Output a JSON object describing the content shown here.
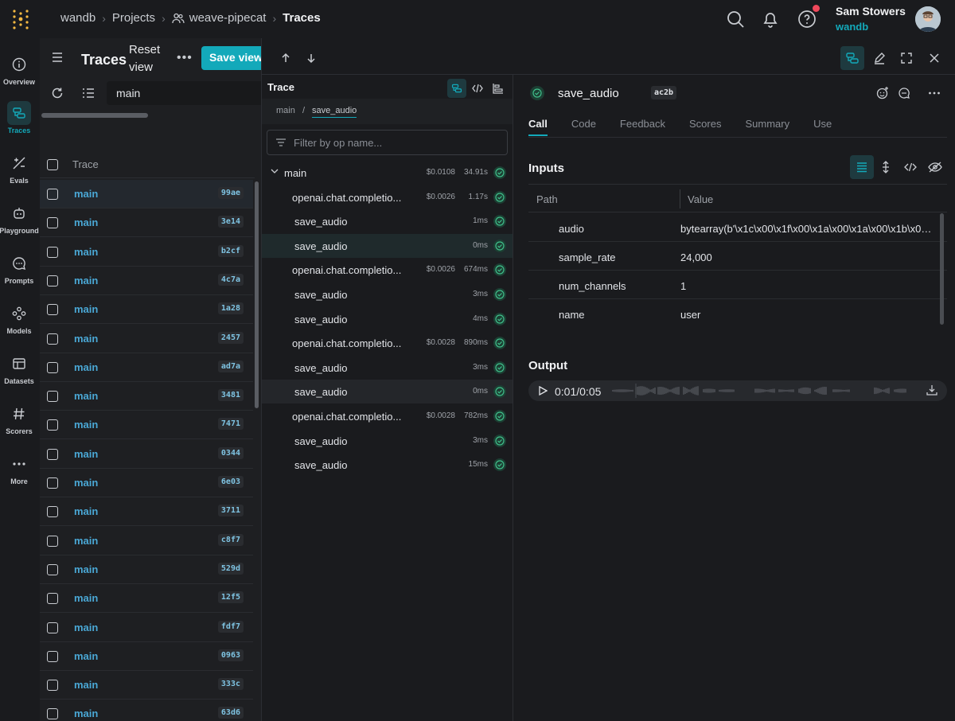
{
  "header": {
    "breadcrumbs": [
      "wandb",
      "Projects",
      "weave-pipecat",
      "Traces"
    ],
    "user_name": "Sam Stowers",
    "user_org": "wandb"
  },
  "nav": [
    {
      "label": "Overview",
      "icon": "info-icon"
    },
    {
      "label": "Traces",
      "icon": "traces-icon",
      "active": true
    },
    {
      "label": "Evals",
      "icon": "evals-icon"
    },
    {
      "label": "Playground",
      "icon": "robot-icon"
    },
    {
      "label": "Prompts",
      "icon": "chat-icon"
    },
    {
      "label": "Models",
      "icon": "models-icon"
    },
    {
      "label": "Datasets",
      "icon": "table-icon"
    },
    {
      "label": "Scorers",
      "icon": "hash-icon"
    },
    {
      "label": "More",
      "icon": "more-icon"
    }
  ],
  "list": {
    "title": "Traces",
    "reset_view": "Reset view",
    "save_view": "Save view",
    "filter_value": "main",
    "column_header": "Trace",
    "rows": [
      {
        "op": "main",
        "id": "99ae"
      },
      {
        "op": "main",
        "id": "3e14"
      },
      {
        "op": "main",
        "id": "b2cf"
      },
      {
        "op": "main",
        "id": "4c7a"
      },
      {
        "op": "main",
        "id": "1a28"
      },
      {
        "op": "main",
        "id": "2457"
      },
      {
        "op": "main",
        "id": "ad7a"
      },
      {
        "op": "main",
        "id": "3481"
      },
      {
        "op": "main",
        "id": "7471"
      },
      {
        "op": "main",
        "id": "0344"
      },
      {
        "op": "main",
        "id": "6e03"
      },
      {
        "op": "main",
        "id": "3711"
      },
      {
        "op": "main",
        "id": "c8f7"
      },
      {
        "op": "main",
        "id": "529d"
      },
      {
        "op": "main",
        "id": "12f5"
      },
      {
        "op": "main",
        "id": "fdf7"
      },
      {
        "op": "main",
        "id": "0963"
      },
      {
        "op": "main",
        "id": "333c"
      },
      {
        "op": "main",
        "id": "63d6"
      }
    ]
  },
  "tree": {
    "title": "Trace",
    "crumbs": [
      "main",
      "/",
      "save_audio"
    ],
    "filter_placeholder": "Filter by op name...",
    "nodes": [
      {
        "name": "main",
        "cost": "$0.0108",
        "dur": "34.91s",
        "depth": 0
      },
      {
        "name": "openai.chat.completio...",
        "cost": "$0.0026",
        "dur": "1.17s",
        "depth": 1
      },
      {
        "name": "save_audio",
        "cost": "",
        "dur": "1ms",
        "depth": 1
      },
      {
        "name": "save_audio",
        "cost": "",
        "dur": "0ms",
        "depth": 1,
        "selected": true
      },
      {
        "name": "openai.chat.completio...",
        "cost": "$0.0026",
        "dur": "674ms",
        "depth": 1
      },
      {
        "name": "save_audio",
        "cost": "",
        "dur": "3ms",
        "depth": 1
      },
      {
        "name": "save_audio",
        "cost": "",
        "dur": "4ms",
        "depth": 1
      },
      {
        "name": "openai.chat.completio...",
        "cost": "$0.0028",
        "dur": "890ms",
        "depth": 1
      },
      {
        "name": "save_audio",
        "cost": "",
        "dur": "3ms",
        "depth": 1
      },
      {
        "name": "save_audio",
        "cost": "",
        "dur": "0ms",
        "depth": 1,
        "hover": true
      },
      {
        "name": "openai.chat.completio...",
        "cost": "$0.0028",
        "dur": "782ms",
        "depth": 1
      },
      {
        "name": "save_audio",
        "cost": "",
        "dur": "3ms",
        "depth": 1
      },
      {
        "name": "save_audio",
        "cost": "",
        "dur": "15ms",
        "depth": 1
      }
    ]
  },
  "call": {
    "name": "save_audio",
    "id": "ac2b",
    "tabs": [
      "Call",
      "Code",
      "Feedback",
      "Scores",
      "Summary",
      "Use"
    ],
    "active_tab": "Call",
    "inputs_title": "Inputs",
    "col_path": "Path",
    "col_value": "Value",
    "inputs": [
      {
        "path": "audio",
        "value": "bytearray(b'\\x1c\\x00\\x1f\\x00\\x1a\\x00\\x1a\\x00\\x1b\\x00\\x1b\\x00"
      },
      {
        "path": "sample_rate",
        "value": "24,000"
      },
      {
        "path": "num_channels",
        "value": "1"
      },
      {
        "path": "name",
        "value": "user"
      }
    ],
    "output_title": "Output",
    "audio_time": "0:01/0:05",
    "audio_progress": 0.2
  },
  "colors": {
    "accent": "#13a9ba",
    "link": "#4aa8d6",
    "success": "#3fbf8a",
    "notification": "#f0485b"
  }
}
